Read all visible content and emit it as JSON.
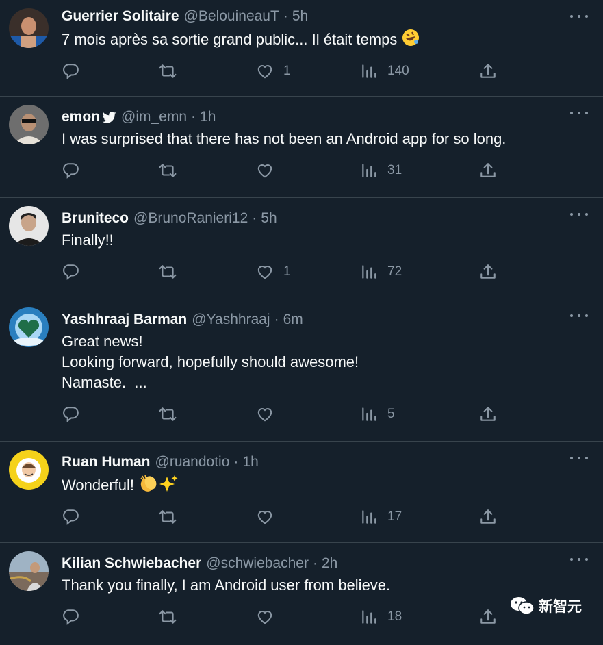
{
  "tweets": [
    {
      "name": "Guerrier Solitaire",
      "handle": "@BelouineauT",
      "time": "5h",
      "verified": false,
      "lines": [
        "7 mois après sa sortie grand public... Il était temps"
      ],
      "emoji": "rolling-on-floor-laughing",
      "replies": "",
      "retweets": "",
      "likes": "1",
      "views": "140",
      "avatar_color": "#3a2f2a"
    },
    {
      "name": "emon",
      "handle": "@im_emn",
      "time": "1h",
      "verified": true,
      "lines": [
        "I was surprised that there has not been an Android app for so long."
      ],
      "emoji": "",
      "replies": "",
      "retweets": "",
      "likes": "",
      "views": "31",
      "avatar_color": "#5a5a5a"
    },
    {
      "name": "Bruniteco",
      "handle": "@BrunoRanieri12",
      "time": "5h",
      "verified": false,
      "lines": [
        "Finally!!"
      ],
      "emoji": "",
      "replies": "",
      "retweets": "",
      "likes": "1",
      "views": "72",
      "avatar_color": "#d8d8d8"
    },
    {
      "name": "Yashhraaj Barman",
      "handle": "@Yashhraaj",
      "time": "6m",
      "verified": false,
      "lines": [
        "Great news!",
        "Looking forward, hopefully should awesome!",
        "Namaste.  ..."
      ],
      "emoji": "",
      "replies": "",
      "retweets": "",
      "likes": "",
      "views": "5",
      "avatar_color": "#2a7fbf"
    },
    {
      "name": "Ruan Human",
      "handle": "@ruandotio",
      "time": "1h",
      "verified": false,
      "lines": [
        "Wonderful!"
      ],
      "emoji": "clapping-hands-sparkles",
      "replies": "",
      "retweets": "",
      "likes": "",
      "views": "17",
      "avatar_color": "#f5d21a"
    },
    {
      "name": "Kilian Schwiebacher",
      "handle": "@schwiebacher",
      "time": "2h",
      "verified": false,
      "lines": [
        "Thank you finally, I am Android user from believe."
      ],
      "emoji": "",
      "replies": "",
      "retweets": "",
      "likes": "",
      "views": "18",
      "avatar_color": "#8a9aa8"
    }
  ],
  "watermark": {
    "text": "新智元",
    "icon": "wechat-icon"
  },
  "colors": {
    "background": "#15202b",
    "muted": "#8b98a5",
    "divider": "#38444d",
    "text": "#f7f9f9"
  }
}
